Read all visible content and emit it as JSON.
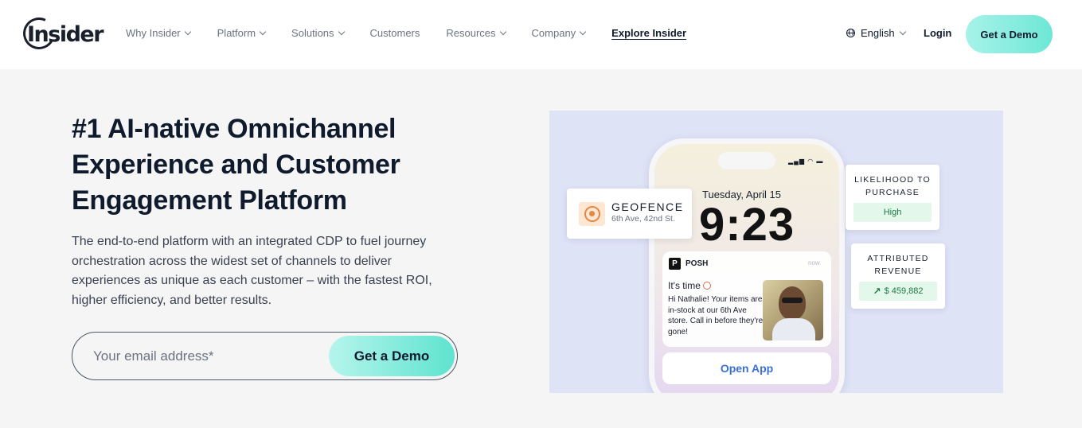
{
  "header": {
    "logo_text": "Insider",
    "nav": [
      {
        "label": "Why Insider",
        "has_dropdown": true
      },
      {
        "label": "Platform",
        "has_dropdown": true
      },
      {
        "label": "Solutions",
        "has_dropdown": true
      },
      {
        "label": "Customers",
        "has_dropdown": false
      },
      {
        "label": "Resources",
        "has_dropdown": true
      },
      {
        "label": "Company",
        "has_dropdown": true
      },
      {
        "label": "Explore Insider",
        "has_dropdown": false
      }
    ],
    "language": "English",
    "language_icon": "globe-icon",
    "login_label": "Login",
    "cta_label": "Get a Demo"
  },
  "hero": {
    "title": "#1 AI-native Omnichannel Experience and Customer Engagement Platform",
    "description": "The end-to-end platform with an integrated CDP to fuel journey orchestration across the widest set of channels to deliver experiences as unique as each customer – with the fastest ROI, higher efficiency, and better results.",
    "email_placeholder": "Your email address*",
    "cta_label": "Get a Demo"
  },
  "visual": {
    "geofence": {
      "title": "GEOFENCE",
      "subtitle": "6th Ave, 42nd St.",
      "icon": "target-icon"
    },
    "phone": {
      "date": "Tuesday, April 15",
      "time": "9:23",
      "notification": {
        "app_name": "POSH",
        "app_logo": "P",
        "time": "now",
        "title": "It's time",
        "body": "Hi Nathalie! Your items are in-stock at our 6th Ave store. Call in before they're gone!"
      },
      "open_app_label": "Open App"
    },
    "metrics": [
      {
        "label": "LIKELIHOOD TO PURCHASE",
        "value": "High"
      },
      {
        "label": "ATTRIBUTED REVENUE",
        "value": "$ 459,882",
        "icon": "trend-up-icon"
      }
    ]
  },
  "colors": {
    "accent_gradient_start": "#b5f5ec",
    "accent_gradient_end": "#5fe3cf",
    "heading": "#0f1b2d",
    "visual_bg": "#dfe3f6",
    "metric_green": "#1d7a45",
    "open_app_blue": "#3a6fd8"
  }
}
